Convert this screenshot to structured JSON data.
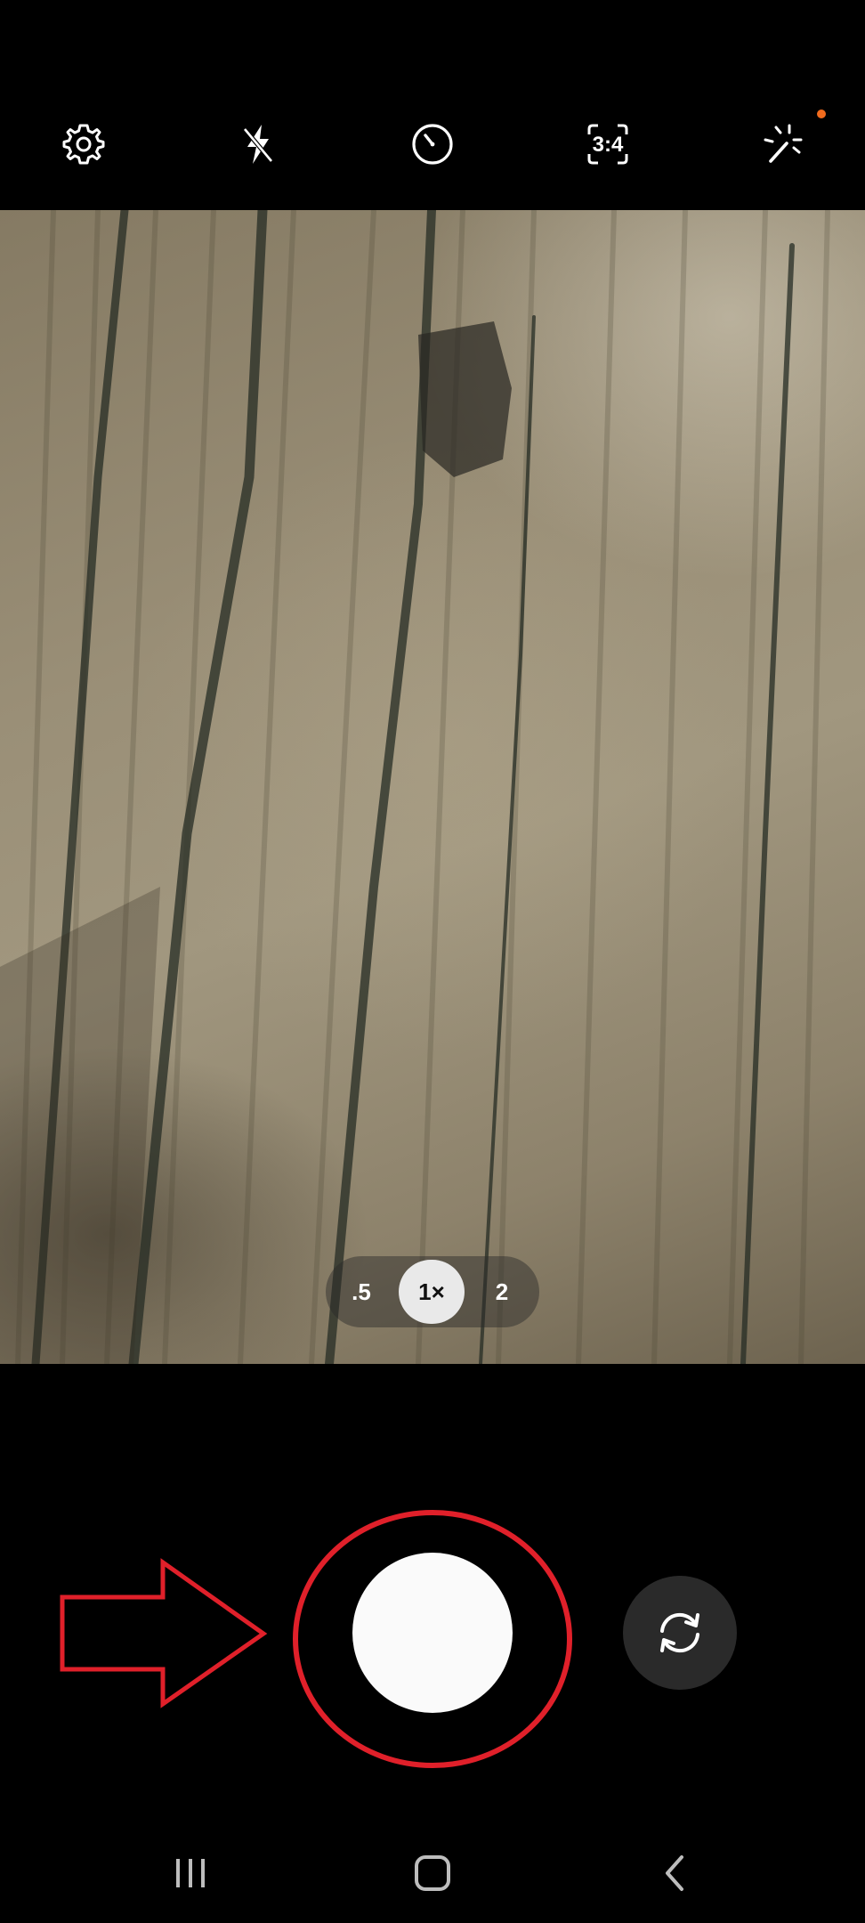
{
  "top_bar": {
    "icons": [
      "gear-icon",
      "flash-off-icon",
      "timer-icon",
      "aspect-ratio-icon",
      "magic-wand-icon"
    ],
    "aspect_ratio_label": "3:4",
    "notification_dot_color": "#f26b1d"
  },
  "zoom": {
    "options": [
      ".5",
      "1×",
      "2"
    ],
    "selected": "1×"
  },
  "bottom_controls": {
    "icons": [
      "shutter-button",
      "camera-flip-icon"
    ],
    "annotation": {
      "shapes": [
        "arrow",
        "ellipse"
      ],
      "color": "#e0202a"
    }
  },
  "nav_bar": {
    "icons": [
      "recent-apps-icon",
      "home-icon",
      "back-icon"
    ]
  },
  "colors": {
    "background": "#000000",
    "annotation_red": "#e0202a",
    "shutter_white": "#fafafa"
  }
}
